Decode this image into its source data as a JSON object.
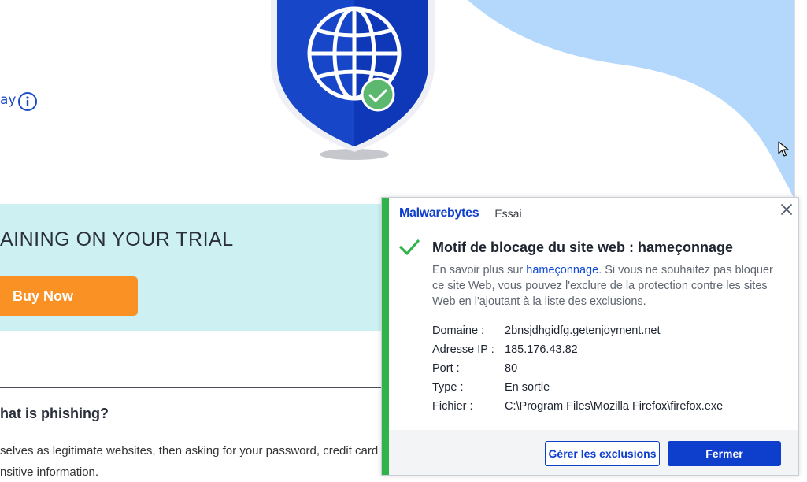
{
  "page": {
    "left_link_fragment": "ay",
    "trial_text": "AINING ON YOUR TRIAL",
    "buy_button": "Buy Now",
    "faq_question": "hat is phishing?",
    "faq_answer_line1": "selves as legitimate websites, then asking for your password, credit card",
    "faq_answer_line2": "nsitive information."
  },
  "popup": {
    "brand": "Malwarebytes",
    "edition": "Essai",
    "title": "Motif de blocage du site web : hameçonnage",
    "desc_prefix": "En savoir plus sur ",
    "desc_link": "hameçonnage",
    "desc_suffix": ". Si vous ne souhaitez pas bloquer ce site Web, vous pouvez l'exclure de la protection contre les sites Web en l'ajoutant à la liste des exclusions.",
    "details": [
      {
        "label": "Domaine :",
        "value": "2bnsjdhgidfg.getenjoyment.net"
      },
      {
        "label": "Adresse IP :",
        "value": "185.176.43.82"
      },
      {
        "label": "Port :",
        "value": "80"
      },
      {
        "label": "Type :",
        "value": "En sortie"
      },
      {
        "label": "Fichier :",
        "value": "C:\\Program Files\\Mozilla Firefox\\firefox.exe"
      }
    ],
    "manage_button": "Gérer les exclusions",
    "close_button": "Fermer"
  },
  "colors": {
    "accent_green": "#2fb34a",
    "brand_blue": "#0d3ecc",
    "buy_orange": "#f99124",
    "trial_band": "#cdf1f2",
    "wave_blue": "#b3d8fb"
  },
  "icons": [
    "globe-icon",
    "checkmark-badge-icon",
    "info-icon",
    "close-icon",
    "check-icon",
    "cursor-icon"
  ]
}
